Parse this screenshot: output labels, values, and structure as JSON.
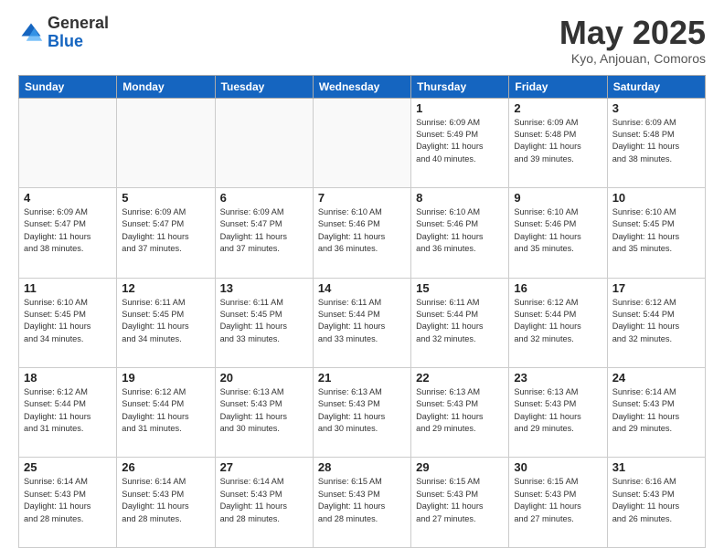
{
  "header": {
    "logo_general": "General",
    "logo_blue": "Blue",
    "month_title": "May 2025",
    "subtitle": "Kyo, Anjouan, Comoros"
  },
  "days_of_week": [
    "Sunday",
    "Monday",
    "Tuesday",
    "Wednesday",
    "Thursday",
    "Friday",
    "Saturday"
  ],
  "weeks": [
    [
      {
        "day": "",
        "info": ""
      },
      {
        "day": "",
        "info": ""
      },
      {
        "day": "",
        "info": ""
      },
      {
        "day": "",
        "info": ""
      },
      {
        "day": "1",
        "info": "Sunrise: 6:09 AM\nSunset: 5:49 PM\nDaylight: 11 hours\nand 40 minutes."
      },
      {
        "day": "2",
        "info": "Sunrise: 6:09 AM\nSunset: 5:48 PM\nDaylight: 11 hours\nand 39 minutes."
      },
      {
        "day": "3",
        "info": "Sunrise: 6:09 AM\nSunset: 5:48 PM\nDaylight: 11 hours\nand 38 minutes."
      }
    ],
    [
      {
        "day": "4",
        "info": "Sunrise: 6:09 AM\nSunset: 5:47 PM\nDaylight: 11 hours\nand 38 minutes."
      },
      {
        "day": "5",
        "info": "Sunrise: 6:09 AM\nSunset: 5:47 PM\nDaylight: 11 hours\nand 37 minutes."
      },
      {
        "day": "6",
        "info": "Sunrise: 6:09 AM\nSunset: 5:47 PM\nDaylight: 11 hours\nand 37 minutes."
      },
      {
        "day": "7",
        "info": "Sunrise: 6:10 AM\nSunset: 5:46 PM\nDaylight: 11 hours\nand 36 minutes."
      },
      {
        "day": "8",
        "info": "Sunrise: 6:10 AM\nSunset: 5:46 PM\nDaylight: 11 hours\nand 36 minutes."
      },
      {
        "day": "9",
        "info": "Sunrise: 6:10 AM\nSunset: 5:46 PM\nDaylight: 11 hours\nand 35 minutes."
      },
      {
        "day": "10",
        "info": "Sunrise: 6:10 AM\nSunset: 5:45 PM\nDaylight: 11 hours\nand 35 minutes."
      }
    ],
    [
      {
        "day": "11",
        "info": "Sunrise: 6:10 AM\nSunset: 5:45 PM\nDaylight: 11 hours\nand 34 minutes."
      },
      {
        "day": "12",
        "info": "Sunrise: 6:11 AM\nSunset: 5:45 PM\nDaylight: 11 hours\nand 34 minutes."
      },
      {
        "day": "13",
        "info": "Sunrise: 6:11 AM\nSunset: 5:45 PM\nDaylight: 11 hours\nand 33 minutes."
      },
      {
        "day": "14",
        "info": "Sunrise: 6:11 AM\nSunset: 5:44 PM\nDaylight: 11 hours\nand 33 minutes."
      },
      {
        "day": "15",
        "info": "Sunrise: 6:11 AM\nSunset: 5:44 PM\nDaylight: 11 hours\nand 32 minutes."
      },
      {
        "day": "16",
        "info": "Sunrise: 6:12 AM\nSunset: 5:44 PM\nDaylight: 11 hours\nand 32 minutes."
      },
      {
        "day": "17",
        "info": "Sunrise: 6:12 AM\nSunset: 5:44 PM\nDaylight: 11 hours\nand 32 minutes."
      }
    ],
    [
      {
        "day": "18",
        "info": "Sunrise: 6:12 AM\nSunset: 5:44 PM\nDaylight: 11 hours\nand 31 minutes."
      },
      {
        "day": "19",
        "info": "Sunrise: 6:12 AM\nSunset: 5:44 PM\nDaylight: 11 hours\nand 31 minutes."
      },
      {
        "day": "20",
        "info": "Sunrise: 6:13 AM\nSunset: 5:43 PM\nDaylight: 11 hours\nand 30 minutes."
      },
      {
        "day": "21",
        "info": "Sunrise: 6:13 AM\nSunset: 5:43 PM\nDaylight: 11 hours\nand 30 minutes."
      },
      {
        "day": "22",
        "info": "Sunrise: 6:13 AM\nSunset: 5:43 PM\nDaylight: 11 hours\nand 29 minutes."
      },
      {
        "day": "23",
        "info": "Sunrise: 6:13 AM\nSunset: 5:43 PM\nDaylight: 11 hours\nand 29 minutes."
      },
      {
        "day": "24",
        "info": "Sunrise: 6:14 AM\nSunset: 5:43 PM\nDaylight: 11 hours\nand 29 minutes."
      }
    ],
    [
      {
        "day": "25",
        "info": "Sunrise: 6:14 AM\nSunset: 5:43 PM\nDaylight: 11 hours\nand 28 minutes."
      },
      {
        "day": "26",
        "info": "Sunrise: 6:14 AM\nSunset: 5:43 PM\nDaylight: 11 hours\nand 28 minutes."
      },
      {
        "day": "27",
        "info": "Sunrise: 6:14 AM\nSunset: 5:43 PM\nDaylight: 11 hours\nand 28 minutes."
      },
      {
        "day": "28",
        "info": "Sunrise: 6:15 AM\nSunset: 5:43 PM\nDaylight: 11 hours\nand 28 minutes."
      },
      {
        "day": "29",
        "info": "Sunrise: 6:15 AM\nSunset: 5:43 PM\nDaylight: 11 hours\nand 27 minutes."
      },
      {
        "day": "30",
        "info": "Sunrise: 6:15 AM\nSunset: 5:43 PM\nDaylight: 11 hours\nand 27 minutes."
      },
      {
        "day": "31",
        "info": "Sunrise: 6:16 AM\nSunset: 5:43 PM\nDaylight: 11 hours\nand 26 minutes."
      }
    ]
  ]
}
